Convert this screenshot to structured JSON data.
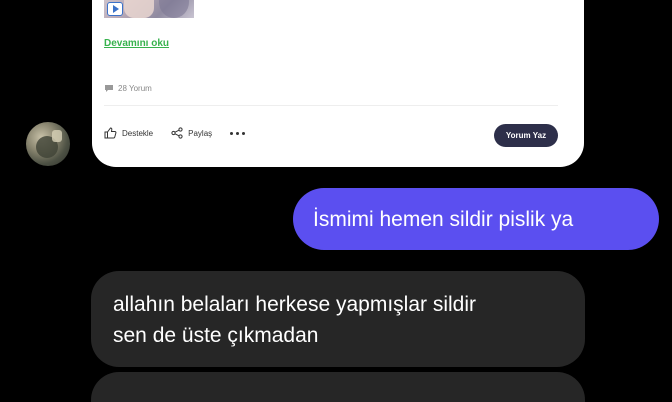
{
  "post_card": {
    "read_more": "Devamını oku",
    "comment_count": "28 Yorum",
    "actions": {
      "support": "Destekle",
      "share": "Paylaş",
      "comment_button": "Yorum Yaz"
    }
  },
  "messages": {
    "outgoing": "İsmimi hemen sildir pislik ya",
    "incoming_line1": "allahın belaları herkese yapmışlar sildir",
    "incoming_line2": "sen de üste çıkmadan"
  },
  "colors": {
    "outgoing_bubble": "#5b4ff0",
    "incoming_bubble": "#262626",
    "link": "#37b24d",
    "button": "#2d2f4a"
  }
}
